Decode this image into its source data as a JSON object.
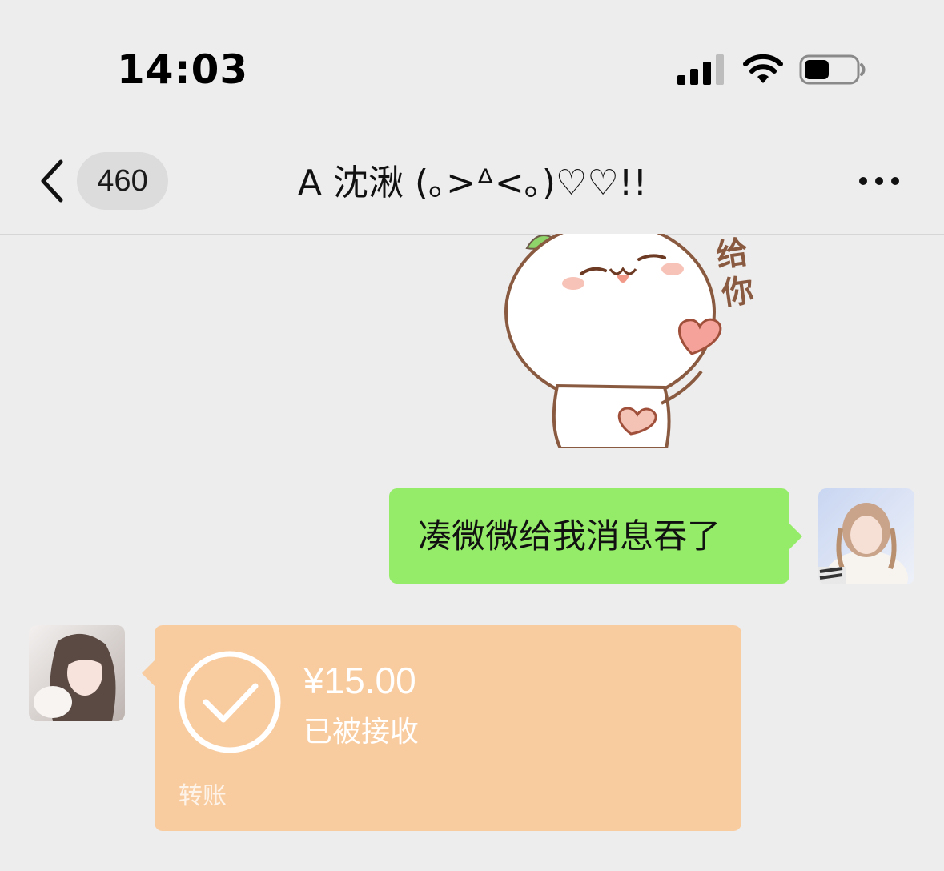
{
  "status_bar": {
    "time": "14:03",
    "icons": [
      "signal-icon",
      "wifi-icon",
      "battery-icon"
    ]
  },
  "nav": {
    "back_icon": "chevron-left-icon",
    "unread_count": "460",
    "title": "A 沈湫 (｡>ᐞ<｡)♡♡!!",
    "more_icon": "more-icon"
  },
  "messages": [
    {
      "type": "sticker",
      "from": "self",
      "caption": "给你"
    },
    {
      "type": "text",
      "from": "self",
      "text": "凑微微给我消息吞了"
    },
    {
      "type": "transfer",
      "from": "other",
      "amount": "¥15.00",
      "status": "已被接收",
      "label": "转账"
    }
  ],
  "colors": {
    "background": "#ededed",
    "self_bubble": "#95ec69",
    "transfer_card": "#f9cca0"
  }
}
